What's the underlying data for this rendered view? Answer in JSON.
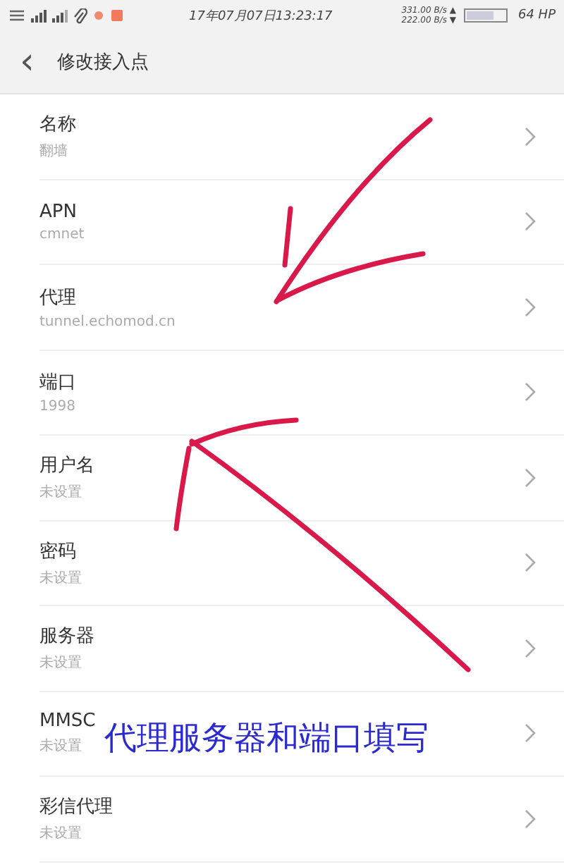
{
  "status_bar": {
    "time": "17年07月07日13:23:17",
    "upload_speed": "331.00 B/s ▲",
    "download_speed": "222.00 B/s ▼",
    "battery_text": "64 HP"
  },
  "header": {
    "back": "‹",
    "title": "修改接入点"
  },
  "settings": [
    {
      "label": "名称",
      "value": "翻墙"
    },
    {
      "label": "APN",
      "value": "cmnet"
    },
    {
      "label": "代理",
      "value": "tunnel.echomod.cn"
    },
    {
      "label": "端口",
      "value": "1998"
    },
    {
      "label": "用户名",
      "value": "未设置"
    },
    {
      "label": "密码",
      "value": "未设置"
    },
    {
      "label": "服务器",
      "value": "未设置"
    },
    {
      "label": "MMSC",
      "value": "未设置"
    },
    {
      "label": "彩信代理",
      "value": "未设置"
    }
  ],
  "annotation": {
    "note": "代理服务器和端口填写"
  }
}
